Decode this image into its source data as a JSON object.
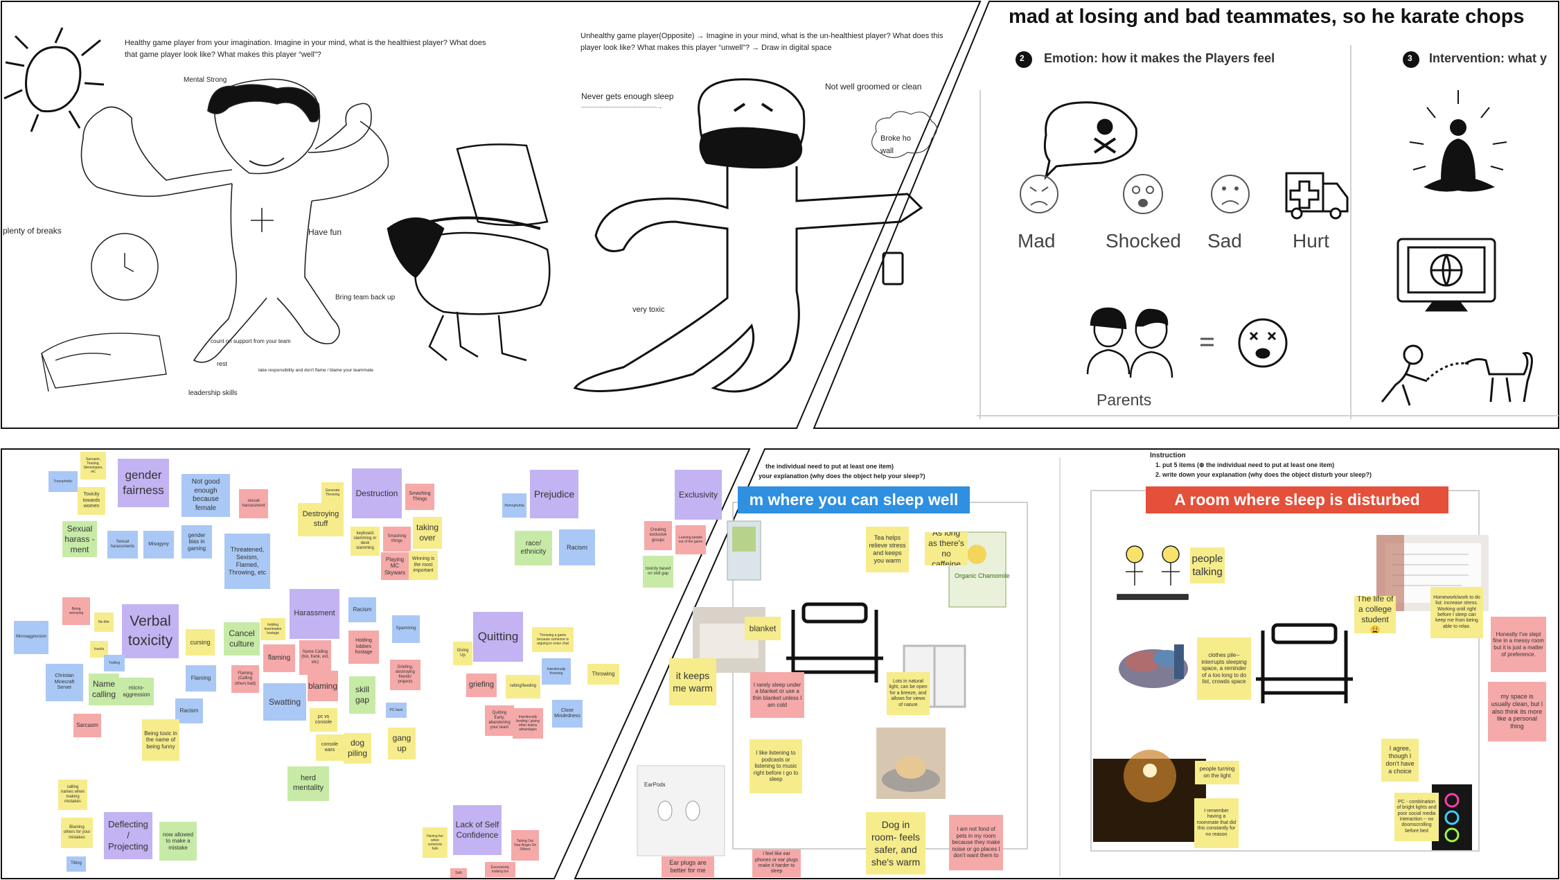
{
  "panel1": {
    "prompt_healthy": "Healthy game player from your imagination.  Imagine in your mind, what is the healthiest player? What does that game player look like? What makes this player “well”?",
    "mental_strong": "Mental Strong",
    "plenty_of_breaks": "plenty of breaks",
    "have_fun": "Have fun",
    "bring_team_back_up": "Bring team back up",
    "count_on_support": "count on support from your team",
    "rest": "rest",
    "take_responsibility": "take responsibility and don't flame / blame your teammate",
    "leadership_skills": "leadership skills",
    "prompt_unhealthy": "Unhealthy game player(Opposite) → Imagine in your mind, what is the un-healthiest player? What does this player look like? What makes this player “unwell”? → Draw in digital space",
    "never_enough_sleep": "Never gets enough sleep",
    "dashed_arrow": "-----------------------------------------→",
    "not_groomed": "Not well groomed or clean",
    "broke_wall": "Broke ho wall",
    "very_toxic": "very toxic"
  },
  "panel2": {
    "header": "mad at losing and bad teammates, so he karate chops",
    "step2_num": "2",
    "step2_title": "Emotion: how it makes the Players feel",
    "step3_num": "3",
    "step3_title": "Intervention: what y",
    "mad": "Mad",
    "shocked": "Shocked",
    "sad": "Sad",
    "hurt": "Hurt",
    "parents": "Parents",
    "equals": "="
  },
  "panel3": {
    "notes": [
      {
        "text": "Sarcasm, Teasing, Stereotypes, etc",
        "color": "#f6ec8b"
      },
      {
        "text": "Transphobic",
        "color": "#a9c8f5"
      },
      {
        "text": "Toxicity towards women",
        "color": "#f6ec8b"
      },
      {
        "text": "gender fairness",
        "color": "#c3b3f2"
      },
      {
        "text": "Not good enough because female",
        "color": "#a9c8f5"
      },
      {
        "text": "sexual harrassment",
        "color": "#f5a9a9"
      },
      {
        "text": "Sexual harass -ment",
        "color": "#c7eba6"
      },
      {
        "text": "Sexual harassments",
        "color": "#a9c8f5"
      },
      {
        "text": "Misogyny",
        "color": "#a9c8f5"
      },
      {
        "text": "gender bias in gaming",
        "color": "#a9c8f5"
      },
      {
        "text": "Threatened, Sexism, Flamed, Throwing, etc",
        "color": "#a9c8f5"
      },
      {
        "text": "Generate Throwing",
        "color": "#f6ec8b"
      },
      {
        "text": "Destruction",
        "color": "#c3b3f2"
      },
      {
        "text": "Smashing Things",
        "color": "#f5a9a9"
      },
      {
        "text": "Destroying stuff",
        "color": "#f6ec8b"
      },
      {
        "text": "keyboard slamming or desk slamming",
        "color": "#f6ec8b"
      },
      {
        "text": "Smashing things",
        "color": "#f5a9a9"
      },
      {
        "text": "taking over",
        "color": "#f6ec8b"
      },
      {
        "text": "Playing MC Skywars",
        "color": "#f5a9a9"
      },
      {
        "text": "Winning is the most important",
        "color": "#f6ec8b"
      },
      {
        "text": "Prejudice",
        "color": "#c3b3f2"
      },
      {
        "text": "Homophobia",
        "color": "#a9c8f5"
      },
      {
        "text": "race/ ethnicity",
        "color": "#c7eba6"
      },
      {
        "text": "Racism",
        "color": "#a9c8f5"
      },
      {
        "text": "Exclusivity",
        "color": "#c3b3f2"
      },
      {
        "text": "Creating exclusive groups",
        "color": "#f5a9a9"
      },
      {
        "text": "Leaving people out of the game",
        "color": "#f5a9a9"
      },
      {
        "text": "toxicity based on skill gap",
        "color": "#c7eba6"
      },
      {
        "text": "Microaggression",
        "color": "#a9c8f5"
      },
      {
        "text": "Being annoying",
        "color": "#f5a9a9"
      },
      {
        "text": "No-lifer",
        "color": "#f6ec8b"
      },
      {
        "text": "Verbal toxicity",
        "color": "#c3b3f2"
      },
      {
        "text": "cursing",
        "color": "#f6ec8b"
      },
      {
        "text": "Cancel culture",
        "color": "#c7eba6"
      },
      {
        "text": "holding teammates hostage",
        "color": "#f6ec8b"
      },
      {
        "text": "Harassment",
        "color": "#c3b3f2"
      },
      {
        "text": "Racism",
        "color": "#a9c8f5"
      },
      {
        "text": "Spamming",
        "color": "#a9c8f5"
      },
      {
        "text": "Insults",
        "color": "#f6ec8b"
      },
      {
        "text": "Trolling",
        "color": "#a9c8f5"
      },
      {
        "text": "Christian Minecraft Server",
        "color": "#a9c8f5"
      },
      {
        "text": "Name calling",
        "color": "#c7eba6"
      },
      {
        "text": "micro-aggression",
        "color": "#c7eba6"
      },
      {
        "text": "Flaming",
        "color": "#a9c8f5"
      },
      {
        "text": "Flaming (Calling others bad)",
        "color": "#f5a9a9"
      },
      {
        "text": "flaming",
        "color": "#f5a9a9"
      },
      {
        "text": "Name Calling (bio, frank, ext, etc)",
        "color": "#f5a9a9"
      },
      {
        "text": "Holding lobbies hostage",
        "color": "#f5a9a9"
      },
      {
        "text": "Griefing, destroying friends' projects",
        "color": "#f5a9a9"
      },
      {
        "text": "Racism",
        "color": "#a9c8f5"
      },
      {
        "text": "Sarcasm",
        "color": "#f5a9a9"
      },
      {
        "text": "Being toxic in the name of being funny",
        "color": "#f6ec8b"
      },
      {
        "text": "Swatting",
        "color": "#a9c8f5"
      },
      {
        "text": "blaming",
        "color": "#f5a9a9"
      },
      {
        "text": "skill gap",
        "color": "#c7eba6"
      },
      {
        "text": "PC hack",
        "color": "#a9c8f5"
      },
      {
        "text": "pc vs console",
        "color": "#f6ec8b"
      },
      {
        "text": "console wars",
        "color": "#f6ec8b"
      },
      {
        "text": "dog piling",
        "color": "#f6ec8b"
      },
      {
        "text": "gang up",
        "color": "#f6ec8b"
      },
      {
        "text": "herd mentality",
        "color": "#c7eba6"
      },
      {
        "text": "Quitting",
        "color": "#c3b3f2"
      },
      {
        "text": "Throwing a game because someone is arguing in voice chat",
        "color": "#f6ec8b"
      },
      {
        "text": "Giving Up",
        "color": "#f6ec8b"
      },
      {
        "text": "Intentionally throwing",
        "color": "#a9c8f5"
      },
      {
        "text": "Throwing",
        "color": "#f6ec8b"
      },
      {
        "text": "griefing",
        "color": "#f5a9a9"
      },
      {
        "text": "ratting/feeding",
        "color": "#f6ec8b"
      },
      {
        "text": "Quitting Early, abandoning your team",
        "color": "#f5a9a9"
      },
      {
        "text": "Intentionally feeding / giving other teams advantages",
        "color": "#f5a9a9"
      },
      {
        "text": "Close Mindedness",
        "color": "#a9c8f5"
      },
      {
        "text": "calling names when making mistakes",
        "color": "#f6ec8b"
      },
      {
        "text": "Blaming others for your mistakes",
        "color": "#f6ec8b"
      },
      {
        "text": "Deflecting / Projecting",
        "color": "#c3b3f2"
      },
      {
        "text": "now allowed to make a mistake",
        "color": "#c7eba6"
      },
      {
        "text": "Tilting",
        "color": "#a9c8f5"
      },
      {
        "text": "Lack of Self Confidence",
        "color": "#c3b3f2"
      },
      {
        "text": "Having fun when someone fails",
        "color": "#f6ec8b"
      },
      {
        "text": "Taking Out Your Anger On Others",
        "color": "#f5a9a9"
      },
      {
        "text": "Excessively making fun",
        "color": "#f5a9a9"
      },
      {
        "text": "Sulk",
        "color": "#f5a9a9"
      }
    ]
  },
  "panel4": {
    "instruction_1": "the individual need to put at least one item)",
    "instruction_2": "your explanation (why does the object help your sleep?)",
    "banner": "m where you can sleep well",
    "notes": [
      {
        "text": "Tea helps relieve stress and keeps you warm",
        "color": "#f6ec8b"
      },
      {
        "text": "As long as there's no caffeine",
        "color": "#f6ec8b"
      },
      {
        "text": "blanket",
        "color": "#f6ec8b"
      },
      {
        "text": "it keeps me warm",
        "color": "#f6ec8b"
      },
      {
        "text": "I rarely sleep under a blanket or use a thin blanket unless I am cold",
        "color": "#f5a9a9"
      },
      {
        "text": "Lots in natural light, can be open for a breeze, and allows for views of nature",
        "color": "#f6ec8b"
      },
      {
        "text": "I like listening to podcasts or listening to music right before i go to sleep",
        "color": "#f6ec8b"
      },
      {
        "text": "Dog in room- feels safer, and she's warm",
        "color": "#f6ec8b"
      },
      {
        "text": "I am not fond of pets in my room because they make noise or go places I don't want them to",
        "color": "#f5a9a9"
      },
      {
        "text": "Ear plugs are better for me",
        "color": "#f5a9a9"
      },
      {
        "text": "I feel like ear phones or ear plugs make it harder to sleep",
        "color": "#f5a9a9"
      }
    ],
    "tea_label": "Organic Chamomile",
    "earpods_label": "EarPods"
  },
  "panel5": {
    "instruction_title": "Instruction",
    "instruction_1": "1. put 5 items (⊕ the individual need to put at least one item)",
    "instruction_2": "2. write down your explanation (why does the object disturb your sleep?)",
    "banner": "A room where sleep is disturbed",
    "notes": [
      {
        "text": "people talking",
        "color": "#f6ec8b"
      },
      {
        "text": "The life of a college student 😩",
        "color": "#f6ec8b"
      },
      {
        "text": "Homework/work to do list: increase stress. Working until right before I sleep can keep me from being able to relax.",
        "color": "#f6ec8b"
      },
      {
        "text": "Honestly I've slept fine in a messy room but it is just a matter of preference.",
        "color": "#f5a9a9"
      },
      {
        "text": "clothes pile-- interrupts sleeping space, a reminder of a too long to do list, crowds space",
        "color": "#f6ec8b"
      },
      {
        "text": "my space is usually clean, but I also think its more like a personal thing",
        "color": "#f5a9a9"
      },
      {
        "text": "I agree, though I don't have a choice",
        "color": "#f6ec8b"
      },
      {
        "text": "people turning on the light",
        "color": "#f6ec8b"
      },
      {
        "text": "I remember having a roommate that did this constantly for no reason",
        "color": "#f6ec8b"
      },
      {
        "text": "PC - combination of bright lights and poor social media interaction -- no doomscrolling before bed",
        "color": "#f6ec8b"
      }
    ]
  },
  "colors": {
    "banner_blue": "#2f8fe0",
    "banner_red": "#e4503a",
    "yellow_note": "#f6ec8b",
    "pink_note": "#f5a9a9",
    "blue_note": "#a9c8f5",
    "purple_note": "#c3b3f2",
    "green_note": "#c7eba6"
  }
}
